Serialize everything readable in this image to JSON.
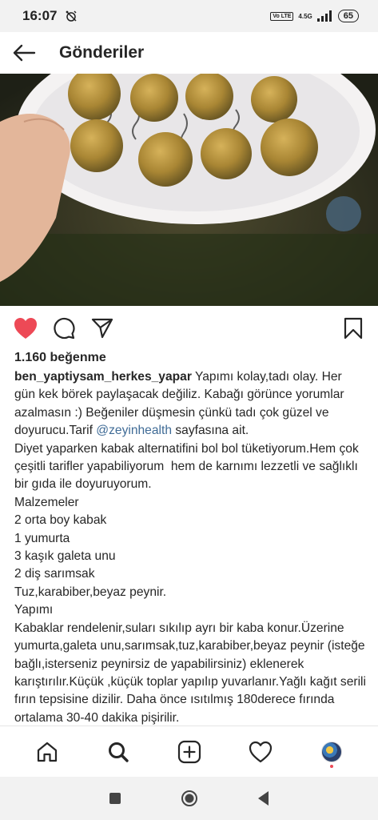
{
  "status_bar": {
    "time": "16:07",
    "volte": "Vo LTE",
    "network": "4.5G",
    "battery": "65"
  },
  "header": {
    "title": "Gönderiler"
  },
  "post": {
    "likes": "1.160 beğenme",
    "username": "ben_yaptiysam_herkes_yapar",
    "caption_part1": " Yapımı kolay,tadı olay. Her gün kek börek paylaşacak değiliz. Kabağı görünce yorumlar azalmasın :) Beğeniler düşmesin çünkü tadı çok güzel ve doyurucu.Tarif ",
    "mention": "@zeyinhealth",
    "caption_part2": " sayfasına ait.\nDiyet yaparken kabak alternatifini bol bol tüketiyorum.Hem çok çeşitli tarifler yapabiliyorum  hem de karnımı lezzetli ve sağlıklı bir gıda ile doyuruyorum.\nMalzemeler\n2 orta boy kabak\n1 yumurta\n3 kaşık galeta unu\n2 diş sarımsak\nTuz,karabiber,beyaz peynir.\nYapımı\nKabaklar rendelenir,suları sıkılıp ayrı bir kaba konur.Üzerine yumurta,galeta unu,sarımsak,tuz,karabiber,beyaz peynir (isteğe bağlı,isterseniz peynirsiz de yapabilirsiniz) eklenerek karıştırılır.Küçük ,küçük toplar yapılıp yuvarlanır.Yağlı kağıt serili fırın tepsisine dizilir. Daha önce ısıtılmış 180derece fırında ortalama 30-40 dakika pişirilir."
  },
  "icons": {
    "back": "arrow-left-icon",
    "like": "heart-filled-icon",
    "comment": "comment-icon",
    "share": "paper-plane-icon",
    "save": "bookmark-icon",
    "nav": [
      "home-icon",
      "search-icon",
      "add-post-icon",
      "activity-heart-icon",
      "profile-avatar"
    ]
  },
  "colors": {
    "like": "#ed4956",
    "mention": "#3f6b96",
    "text": "#262626"
  }
}
